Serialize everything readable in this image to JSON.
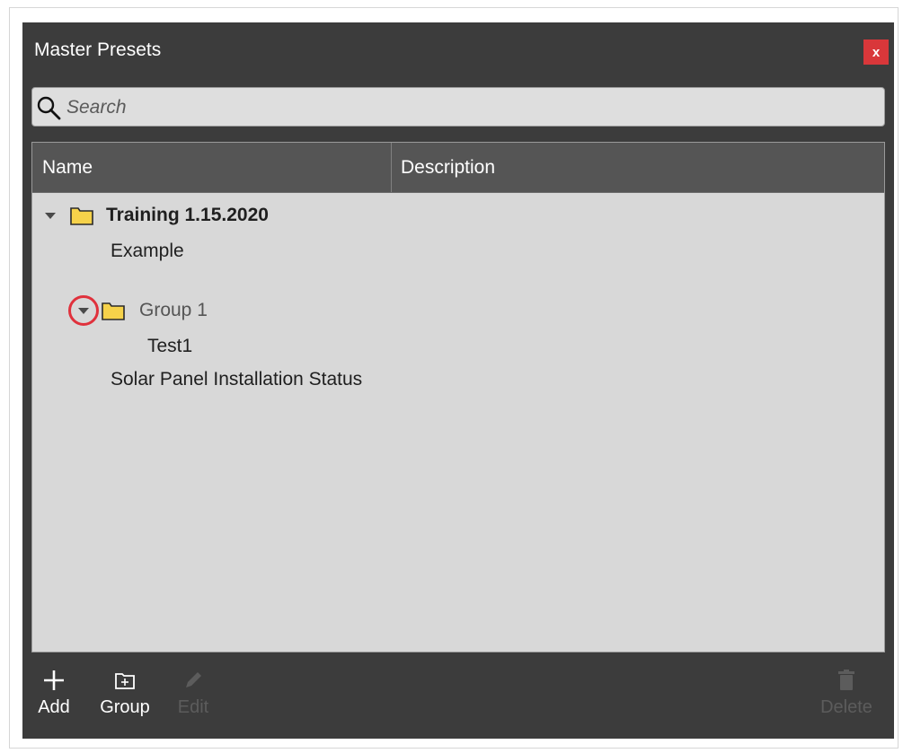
{
  "window": {
    "title": "Master Presets",
    "close_label": "x"
  },
  "search": {
    "placeholder": "Search",
    "value": ""
  },
  "grid": {
    "columns": [
      "Name",
      "Description"
    ],
    "rows": [
      {
        "label": "Training 1.15.2020",
        "type": "folder",
        "expanded": true,
        "bold": true
      },
      {
        "label": "Example",
        "type": "preset"
      },
      {
        "label": "Group 1",
        "type": "folder",
        "expanded": true,
        "bold": false
      },
      {
        "label": "Test1",
        "type": "preset"
      },
      {
        "label": "Solar Panel Installation Status",
        "type": "preset"
      }
    ]
  },
  "toolbar": {
    "add_label": "Add",
    "group_label": "Group",
    "edit_label": "Edit",
    "delete_label": "Delete"
  },
  "colors": {
    "dialog_bg": "#3c3c3c",
    "close_bg": "#d9373a",
    "folder": "#f6d24a",
    "highlight": "#e0313c",
    "grid_bg": "#d8d8d8"
  }
}
